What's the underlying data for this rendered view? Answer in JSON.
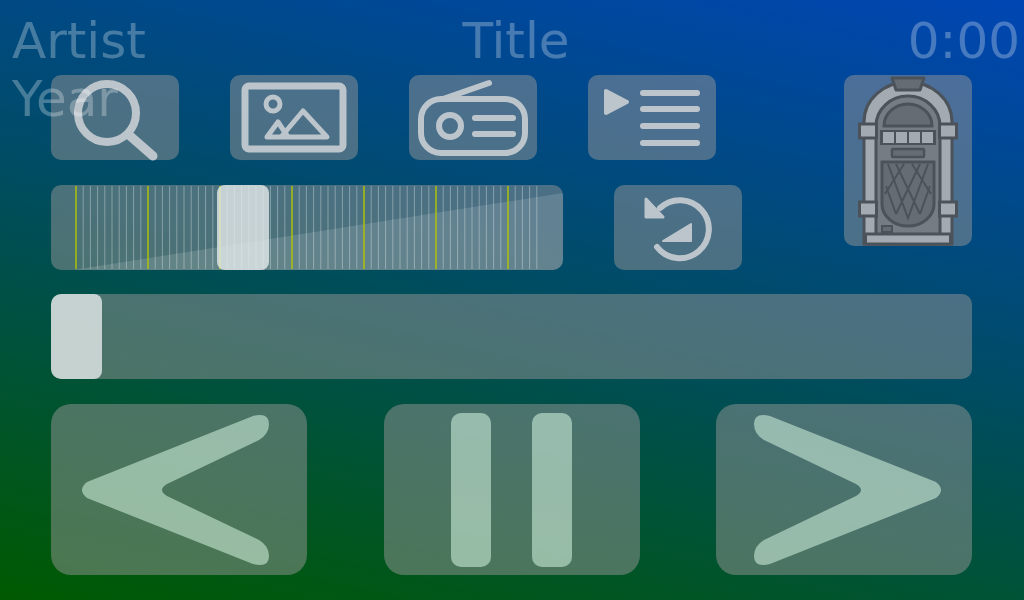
{
  "header": {
    "artist": "Artist",
    "year": "Year",
    "title": "Title",
    "time": "0:00"
  },
  "volume_slider": {
    "level": 0.36
  },
  "seek_bar": {
    "level": 0
  },
  "playback": {
    "playing": true
  }
}
